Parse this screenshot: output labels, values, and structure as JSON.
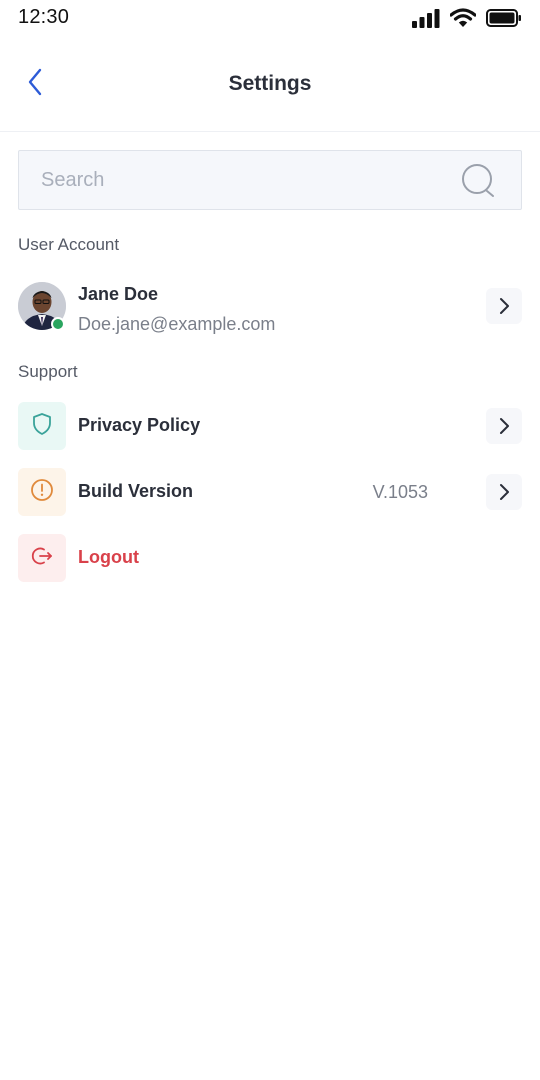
{
  "status_bar": {
    "time": "12:30",
    "icons": [
      "signal-icon",
      "wifi-icon",
      "battery-icon"
    ]
  },
  "header": {
    "title": "Settings",
    "back_icon": "chevron-left-icon"
  },
  "search": {
    "placeholder": "Search",
    "value": "",
    "icon": "search-icon"
  },
  "sections": {
    "user_account": "User Account",
    "support": "Support"
  },
  "user": {
    "name": "Jane Doe",
    "email": "Doe.jane@example.com",
    "online": true
  },
  "support_items": [
    {
      "label": "Privacy Policy",
      "icon": "shield-icon",
      "value": ""
    },
    {
      "label": "Build Version",
      "icon": "alert-circle-icon",
      "value": "V.1053"
    },
    {
      "label": "Logout",
      "icon": "logout-icon",
      "value": ""
    }
  ],
  "colors": {
    "accent": "#2d5bd7",
    "online": "#2aa55f",
    "privacy_icon": "#3aa39a",
    "build_icon": "#e08a3c",
    "logout": "#d9414a"
  }
}
